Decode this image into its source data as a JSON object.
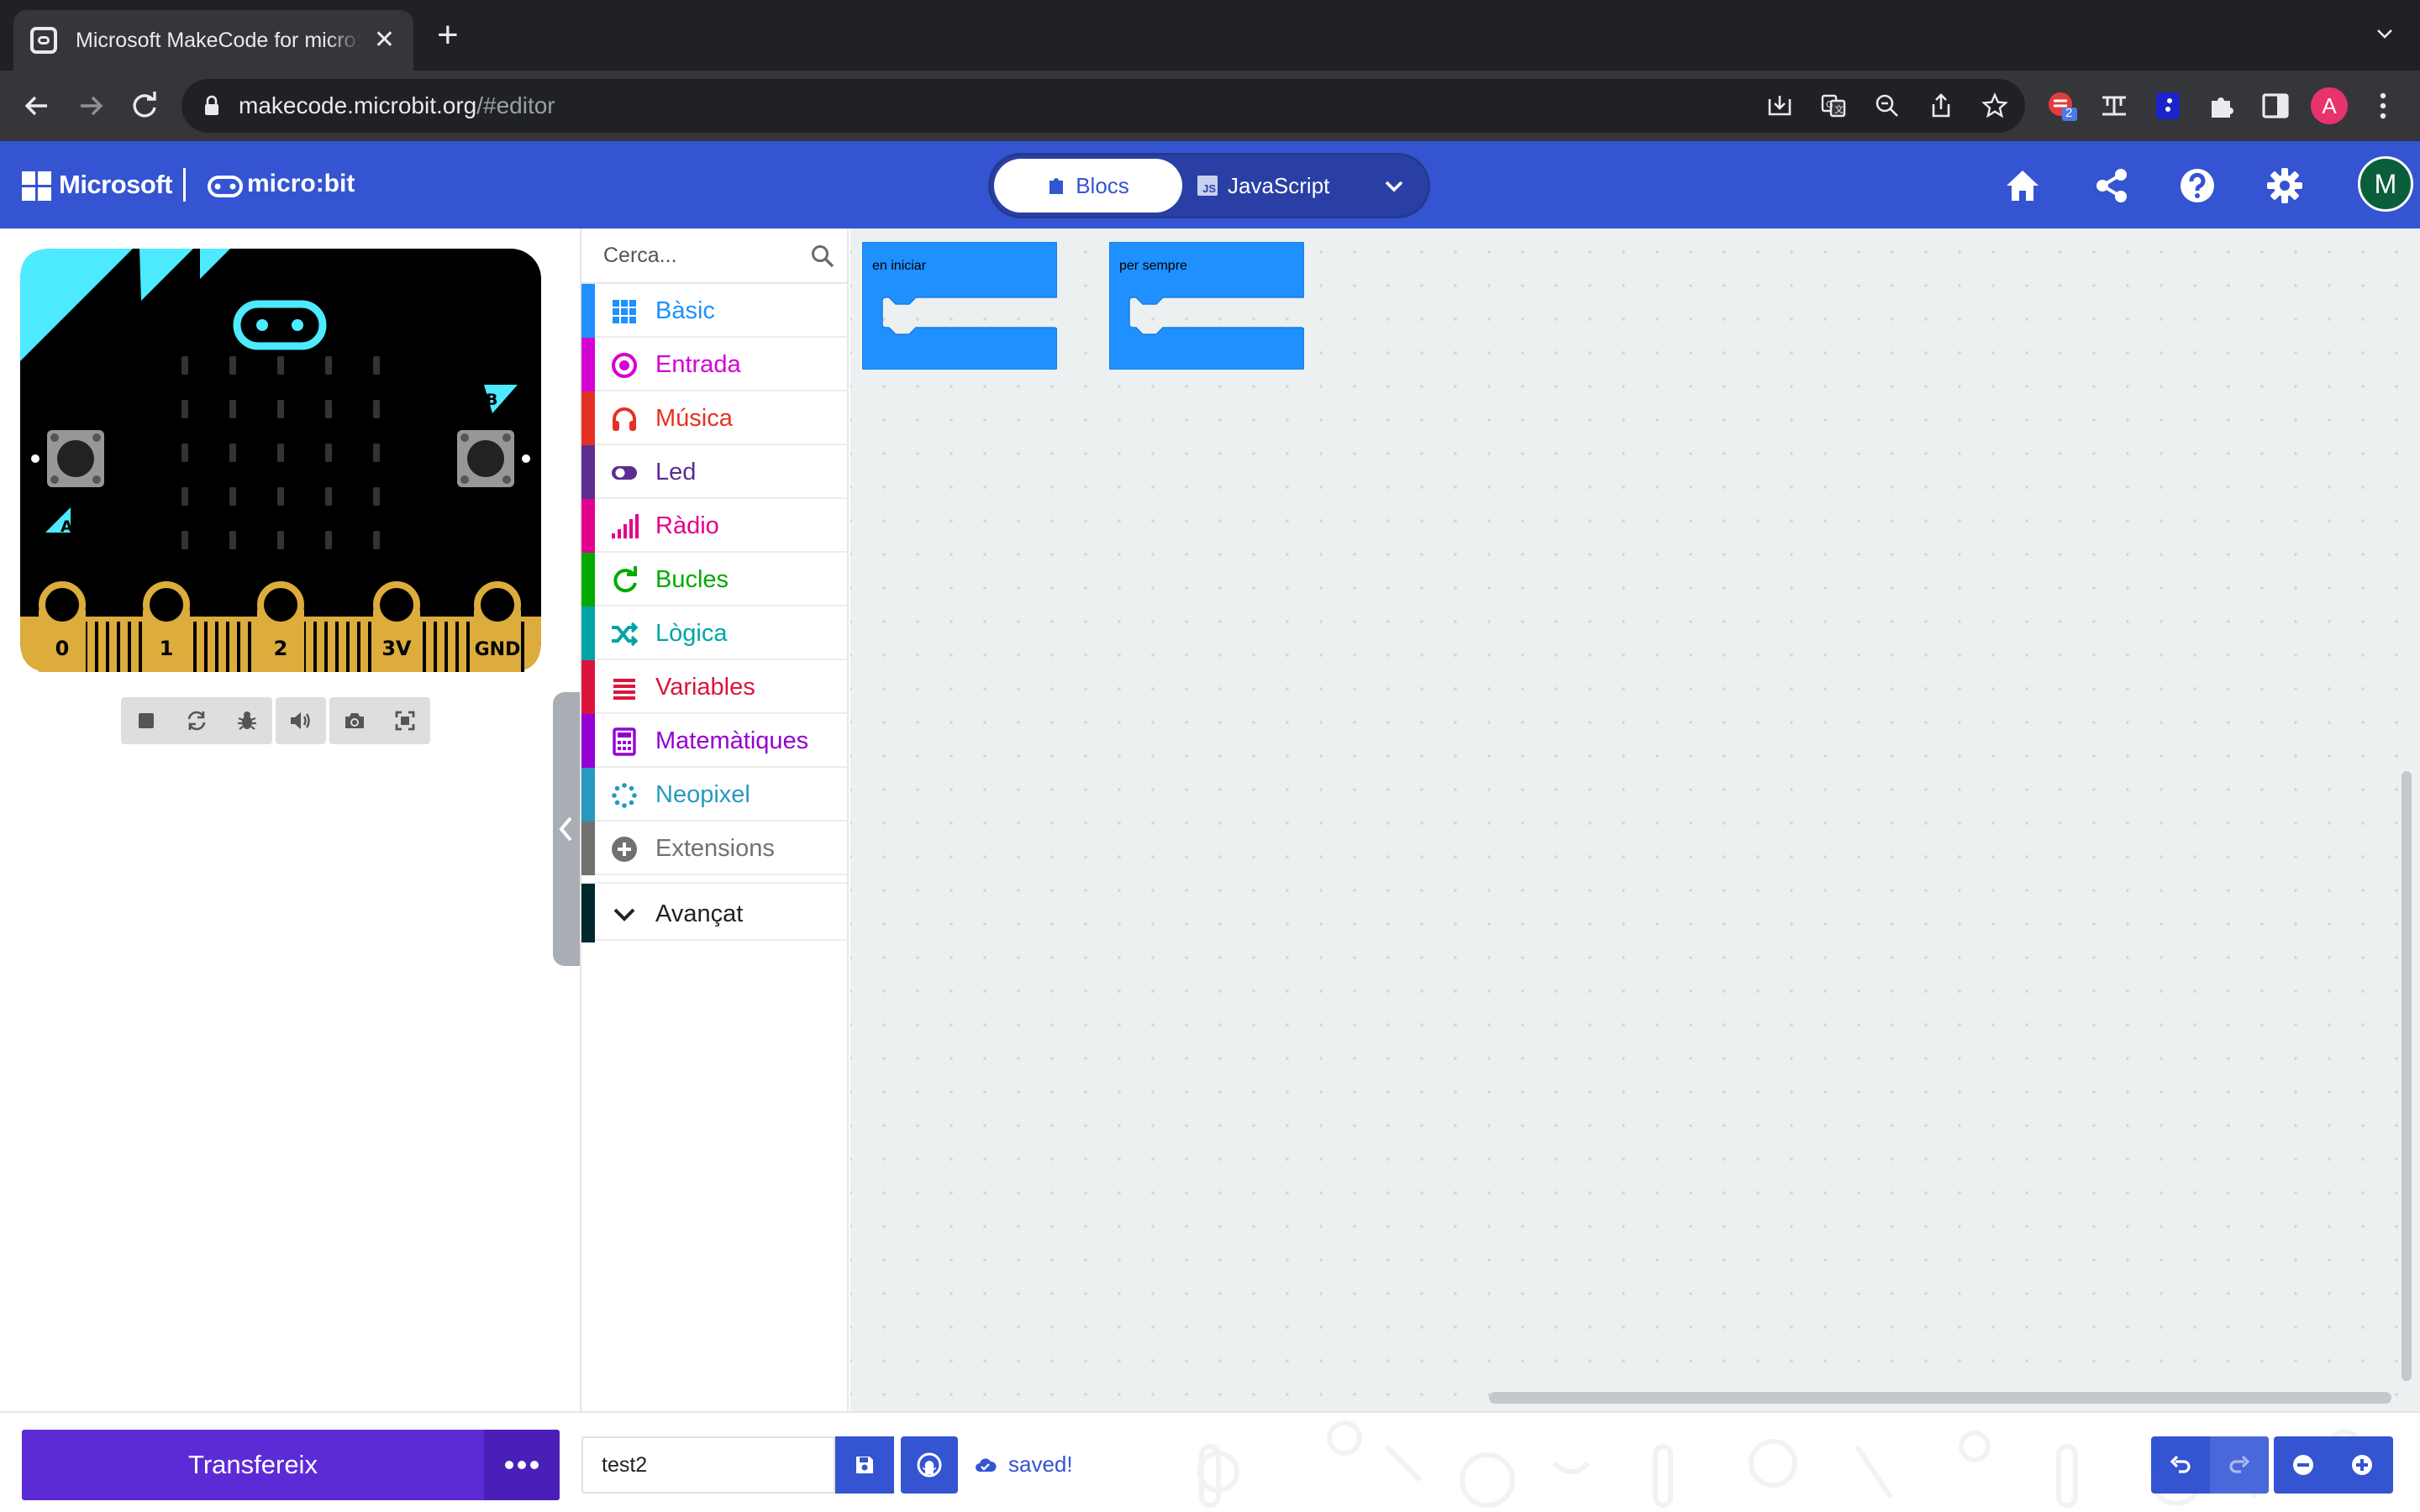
{
  "browser": {
    "tab_title": "Microsoft MakeCode for micro:bit",
    "url_host": "makecode.microbit.org",
    "url_path": "/#editor",
    "profile_initial": "A",
    "extension_badge": "2"
  },
  "header": {
    "brand_microsoft": "Microsoft",
    "brand_microbit": "micro:bit",
    "blocks_label": "Blocs",
    "javascript_label": "JavaScript",
    "js_badge": "JS",
    "user_initial": "M"
  },
  "simulator": {
    "pins": [
      "0",
      "1",
      "2",
      "3V",
      "GND"
    ],
    "button_a": "A",
    "button_b": "B"
  },
  "toolbox": {
    "search_placeholder": "Cerca...",
    "categories": [
      {
        "label": "Bàsic",
        "color": "#1e90ff",
        "icon": "grid-icon"
      },
      {
        "label": "Entrada",
        "color": "#d400d4",
        "icon": "target-icon"
      },
      {
        "label": "Música",
        "color": "#e63022",
        "icon": "headphones-icon"
      },
      {
        "label": "Led",
        "color": "#5c2d91",
        "icon": "toggle-icon"
      },
      {
        "label": "Ràdio",
        "color": "#e3008c",
        "icon": "signal-bars-icon"
      },
      {
        "label": "Bucles",
        "color": "#00aa00",
        "icon": "loop-icon"
      },
      {
        "label": "Lògica",
        "color": "#00a4a6",
        "icon": "shuffle-icon"
      },
      {
        "label": "Variables",
        "color": "#dc143c",
        "icon": "lines-icon"
      },
      {
        "label": "Matemàtiques",
        "color": "#9400d3",
        "icon": "calculator-icon"
      },
      {
        "label": "Neopixel",
        "color": "#2699bf",
        "icon": "dotted-circle-icon"
      },
      {
        "label": "Extensions",
        "color": "#717171",
        "icon": "plus-circle-icon"
      }
    ],
    "advanced_label": "Avançat",
    "advanced_color": "#00272b"
  },
  "workspace": {
    "blocks": [
      {
        "label": "en iniciar",
        "color": "#1e90ff"
      },
      {
        "label": "per sempre",
        "color": "#1e90ff"
      }
    ]
  },
  "bottombar": {
    "download_label": "Transfereix",
    "project_name": "test2",
    "save_status": "saved!"
  },
  "colors": {
    "accent": "#3454d1",
    "download": "#5c2bd6",
    "board_accent": "#4eeaff",
    "board_gold": "#dcac3c"
  }
}
